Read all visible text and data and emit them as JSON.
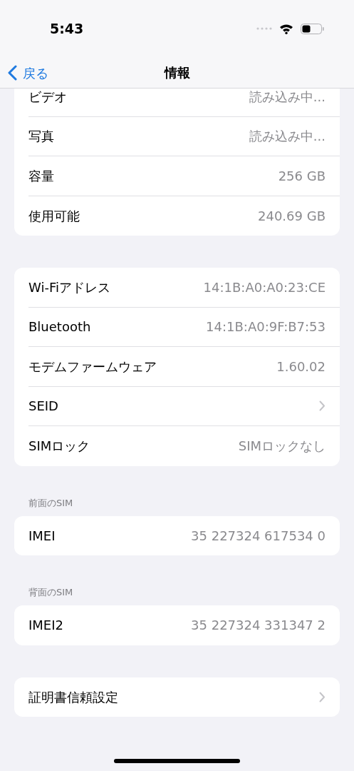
{
  "status_bar": {
    "time": "5:43"
  },
  "nav": {
    "back": "戻る",
    "title": "情報"
  },
  "groups": [
    {
      "rows": [
        {
          "kind": "value",
          "label": "ビデオ",
          "value": "読み込み中..."
        },
        {
          "kind": "value",
          "label": "写真",
          "value": "読み込み中..."
        },
        {
          "kind": "value",
          "label": "容量",
          "value": "256 GB"
        },
        {
          "kind": "value",
          "label": "使用可能",
          "value": "240.69 GB"
        }
      ]
    },
    {
      "rows": [
        {
          "kind": "value",
          "label": "Wi-Fiアドレス",
          "value": "14:1B:A0:A0:23:CE"
        },
        {
          "kind": "value",
          "label": "Bluetooth",
          "value": "14:1B:A0:9F:B7:53"
        },
        {
          "kind": "value",
          "label": "モデムファームウェア",
          "value": "1.60.02"
        },
        {
          "kind": "link",
          "label": "SEID"
        },
        {
          "kind": "value",
          "label": "SIMロック",
          "value": "SIMロックなし"
        }
      ]
    },
    {
      "header": "前面のSIM",
      "rows": [
        {
          "kind": "value",
          "label": "IMEI",
          "value": "35 227324 617534 0"
        }
      ]
    },
    {
      "header": "背面のSIM",
      "rows": [
        {
          "kind": "value",
          "label": "IMEI2",
          "value": "35 227324 331347 2"
        }
      ]
    },
    {
      "rows": [
        {
          "kind": "link",
          "label": "証明書信頼設定"
        }
      ]
    }
  ]
}
